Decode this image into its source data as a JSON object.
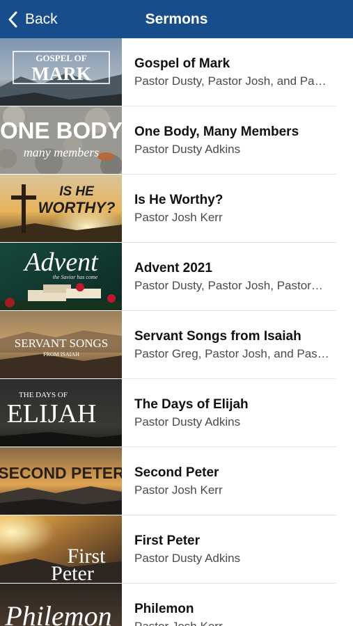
{
  "navbar": {
    "back_label": "Back",
    "title": "Sermons",
    "background_color": "#164d8a"
  },
  "sermons": [
    {
      "title": "Gospel of Mark",
      "speakers": "Pastor Dusty, Pastor Josh, and Pas…",
      "artwork_text": [
        "GOSPEL OF",
        "MARK"
      ]
    },
    {
      "title": "One Body, Many Members",
      "speakers": "Pastor Dusty Adkins",
      "artwork_text": [
        "ONE BODY",
        "many members"
      ]
    },
    {
      "title": "Is He Worthy?",
      "speakers": "Pastor Josh Kerr",
      "artwork_text": [
        "IS HE",
        "WORTHY?"
      ]
    },
    {
      "title": "Advent 2021",
      "speakers": "Pastor Dusty, Pastor Josh, Pastor…",
      "artwork_text": [
        "Advent",
        "the Savior has come"
      ]
    },
    {
      "title": "Servant Songs from Isaiah",
      "speakers": "Pastor Greg, Pastor Josh, and Past…",
      "artwork_text": [
        "SERVANT SONGS",
        "FROM ISAIAH"
      ]
    },
    {
      "title": "The Days of Elijah",
      "speakers": "Pastor Dusty Adkins",
      "artwork_text": [
        "THE DAYS OF",
        "ELIJAH"
      ]
    },
    {
      "title": "Second Peter",
      "speakers": "Pastor Josh Kerr",
      "artwork_text": [
        "SECOND PETER"
      ]
    },
    {
      "title": "First Peter",
      "speakers": "Pastor Dusty Adkins",
      "artwork_text": [
        "First",
        "Peter"
      ]
    },
    {
      "title": "Philemon",
      "speakers": "Pastor Josh Kerr",
      "artwork_text": [
        "Philemon"
      ]
    }
  ]
}
